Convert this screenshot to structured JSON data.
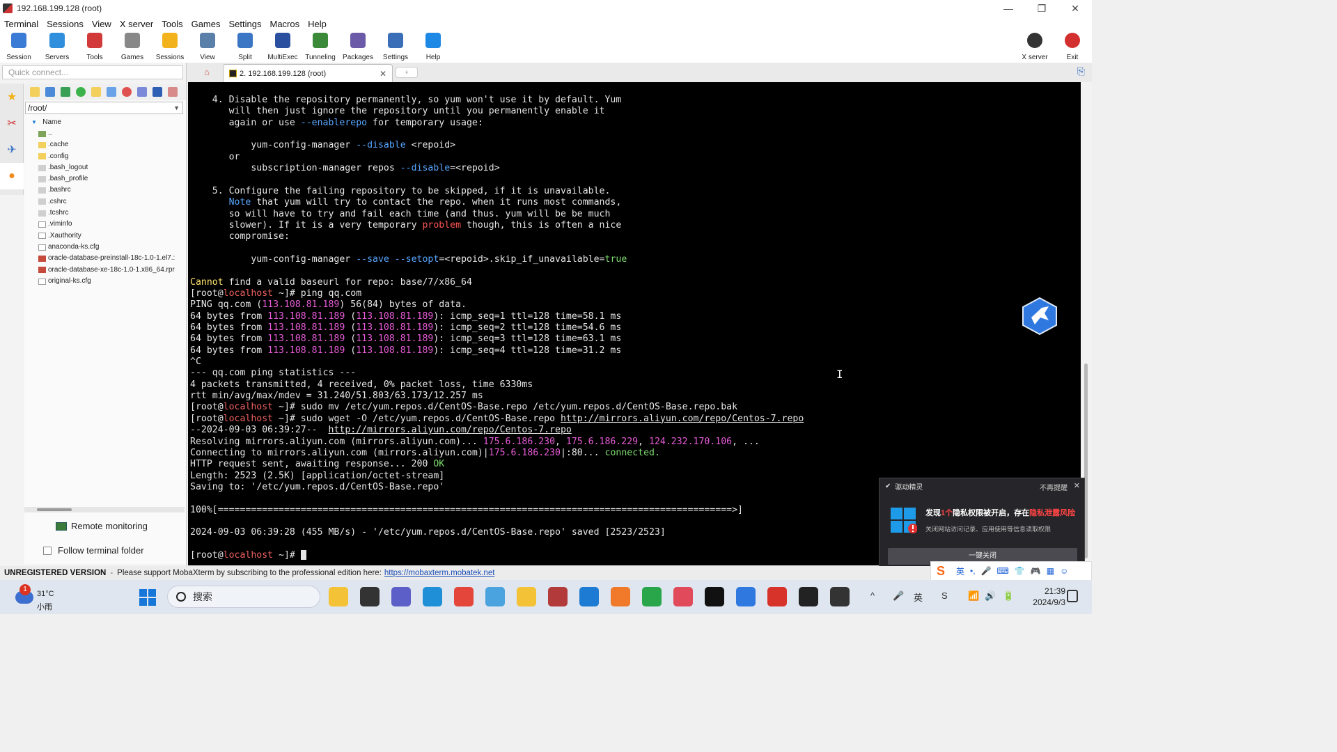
{
  "window": {
    "title": "192.168.199.128 (root)",
    "controls": [
      "—",
      "❐",
      "✕"
    ]
  },
  "menu": [
    "Terminal",
    "Sessions",
    "View",
    "X server",
    "Tools",
    "Games",
    "Settings",
    "Macros",
    "Help"
  ],
  "toolbar": {
    "items": [
      {
        "label": "Session",
        "icon": "session-icon",
        "color": "#3a7bd5"
      },
      {
        "label": "Servers",
        "icon": "servers-icon",
        "color": "#2f8fdc"
      },
      {
        "label": "Tools",
        "icon": "tools-icon",
        "color": "#d23a3a"
      },
      {
        "label": "Games",
        "icon": "games-icon",
        "color": "#888888"
      },
      {
        "label": "Sessions",
        "icon": "star-icon",
        "color": "#f2b21b"
      },
      {
        "label": "View",
        "icon": "view-icon",
        "color": "#5a7fa8"
      },
      {
        "label": "Split",
        "icon": "split-icon",
        "color": "#3b76c4"
      },
      {
        "label": "MultiExec",
        "icon": "multiexec-icon",
        "color": "#2a4f9e"
      },
      {
        "label": "Tunneling",
        "icon": "tunneling-icon",
        "color": "#3a8a3a"
      },
      {
        "label": "Packages",
        "icon": "packages-icon",
        "color": "#6a5aa8"
      },
      {
        "label": "Settings",
        "icon": "settings-icon",
        "color": "#3a6fb8"
      },
      {
        "label": "Help",
        "icon": "help-icon",
        "color": "#1e88e5"
      }
    ],
    "right": [
      {
        "label": "X server",
        "icon": "xserver-icon",
        "color": "#333333"
      },
      {
        "label": "Exit",
        "icon": "exit-icon",
        "color": "#d32f2f"
      }
    ]
  },
  "sidebar": {
    "quick_connect_placeholder": "Quick connect...",
    "path": "/root/",
    "tree_header": "Name",
    "files": [
      {
        "name": "..",
        "type": "up"
      },
      {
        "name": ".cache",
        "type": "folder"
      },
      {
        "name": ".config",
        "type": "folder"
      },
      {
        "name": ".bash_logout",
        "type": "file"
      },
      {
        "name": ".bash_profile",
        "type": "file"
      },
      {
        "name": ".bashrc",
        "type": "file"
      },
      {
        "name": ".cshrc",
        "type": "file"
      },
      {
        "name": ".tcshrc",
        "type": "file"
      },
      {
        "name": ".viminfo",
        "type": "cfg"
      },
      {
        "name": ".Xauthority",
        "type": "cfg"
      },
      {
        "name": "anaconda-ks.cfg",
        "type": "cfg"
      },
      {
        "name": "oracle-database-preinstall-18c-1.0-1.el7.:",
        "type": "rpm"
      },
      {
        "name": "oracle-database-xe-18c-1.0-1.x86_64.rpr",
        "type": "rpm"
      },
      {
        "name": "original-ks.cfg",
        "type": "cfg"
      }
    ],
    "remote_monitoring": "Remote monitoring",
    "follow_folder": "Follow terminal folder"
  },
  "tabs": {
    "active": "2. 192.168.199.128 (root)",
    "close": "✕"
  },
  "terminal": {
    "lines": [
      [
        {
          "t": "    4. Disable the repository permanently, so yum won't use it by default. Yum"
        }
      ],
      [
        {
          "t": "       will then just ignore the repository until you permanently enable it"
        }
      ],
      [
        {
          "t": "       again or use "
        },
        {
          "t": "--enablerepo",
          "c": "flag"
        },
        {
          "t": " for temporary usage:"
        }
      ],
      [
        {
          "t": ""
        }
      ],
      [
        {
          "t": "           yum-config-manager "
        },
        {
          "t": "--disable",
          "c": "flag"
        },
        {
          "t": " <repoid>"
        }
      ],
      [
        {
          "t": "       or"
        }
      ],
      [
        {
          "t": "           subscription-manager repos "
        },
        {
          "t": "--disable",
          "c": "flag"
        },
        {
          "t": "=<repoid>"
        }
      ],
      [
        {
          "t": ""
        }
      ],
      [
        {
          "t": "    5. Configure the failing repository to be skipped, if it is unavailable."
        }
      ],
      [
        {
          "t": "       "
        },
        {
          "t": "Note",
          "c": "flag"
        },
        {
          "t": " that yum will try to contact the repo. when it runs most commands,"
        }
      ],
      [
        {
          "t": "       so will have to try and fail each time (and thus. yum will be be much"
        }
      ],
      [
        {
          "t": "       slower). If it is a very temporary "
        },
        {
          "t": "problem",
          "c": "err"
        },
        {
          "t": " though, this is often a nice"
        }
      ],
      [
        {
          "t": "       compromise:"
        }
      ],
      [
        {
          "t": ""
        }
      ],
      [
        {
          "t": "           yum-config-manager "
        },
        {
          "t": "--save",
          "c": "flag"
        },
        {
          "t": " "
        },
        {
          "t": "--setopt",
          "c": "flag"
        },
        {
          "t": "=<repoid>.skip_if_unavailable="
        },
        {
          "t": "true",
          "c": "pos"
        }
      ],
      [
        {
          "t": ""
        }
      ],
      [
        {
          "t": "Cannot",
          "c": "warn"
        },
        {
          "t": " find a valid baseurl for repo: base/7/x86_64"
        }
      ],
      [
        {
          "t": "[root@"
        },
        {
          "t": "localhost",
          "c": "loc"
        },
        {
          "t": " ~]# ping qq.com"
        }
      ],
      [
        {
          "t": "PING qq.com ("
        },
        {
          "t": "113.108.81.189",
          "c": "ip"
        },
        {
          "t": ") 56(84) bytes of data."
        }
      ],
      [
        {
          "t": "64 bytes from "
        },
        {
          "t": "113.108.81.189",
          "c": "ip"
        },
        {
          "t": " ("
        },
        {
          "t": "113.108.81.189",
          "c": "ip"
        },
        {
          "t": "): icmp_seq=1 ttl=128 time=58.1 ms"
        }
      ],
      [
        {
          "t": "64 bytes from "
        },
        {
          "t": "113.108.81.189",
          "c": "ip"
        },
        {
          "t": " ("
        },
        {
          "t": "113.108.81.189",
          "c": "ip"
        },
        {
          "t": "): icmp_seq=2 ttl=128 time=54.6 ms"
        }
      ],
      [
        {
          "t": "64 bytes from "
        },
        {
          "t": "113.108.81.189",
          "c": "ip"
        },
        {
          "t": " ("
        },
        {
          "t": "113.108.81.189",
          "c": "ip"
        },
        {
          "t": "): icmp_seq=3 ttl=128 time=63.1 ms"
        }
      ],
      [
        {
          "t": "64 bytes from "
        },
        {
          "t": "113.108.81.189",
          "c": "ip"
        },
        {
          "t": " ("
        },
        {
          "t": "113.108.81.189",
          "c": "ip"
        },
        {
          "t": "): icmp_seq=4 ttl=128 time=31.2 ms"
        }
      ],
      [
        {
          "t": "^C"
        }
      ],
      [
        {
          "t": "--- qq.com ping statistics ---"
        }
      ],
      [
        {
          "t": "4 packets transmitted, 4 received, 0% packet loss, time 6330ms"
        }
      ],
      [
        {
          "t": "rtt min/avg/max/mdev = 31.240/51.803/63.173/12.257 ms"
        }
      ],
      [
        {
          "t": "[root@"
        },
        {
          "t": "localhost",
          "c": "loc"
        },
        {
          "t": " ~]# sudo mv /etc/yum.repos.d/CentOS-Base.repo /etc/yum.repos.d/CentOS-Base.repo.bak"
        }
      ],
      [
        {
          "t": "[root@"
        },
        {
          "t": "localhost",
          "c": "loc"
        },
        {
          "t": " ~]# sudo wget -O /etc/yum.repos.d/CentOS-Base.repo "
        },
        {
          "t": "http://mirrors.aliyun.com/repo/Centos-7.repo",
          "c": "lnk"
        }
      ],
      [
        {
          "t": "--2024-09-03 06:39:27--  "
        },
        {
          "t": "http://mirrors.aliyun.com/repo/Centos-7.repo",
          "c": "lnk"
        }
      ],
      [
        {
          "t": "Resolving mirrors.aliyun.com (mirrors.aliyun.com)... "
        },
        {
          "t": "175.6.186.230",
          "c": "ip"
        },
        {
          "t": ", "
        },
        {
          "t": "175.6.186.229",
          "c": "ip"
        },
        {
          "t": ", "
        },
        {
          "t": "124.232.170.106",
          "c": "ip"
        },
        {
          "t": ", ..."
        }
      ],
      [
        {
          "t": "Connecting to mirrors.aliyun.com (mirrors.aliyun.com)|"
        },
        {
          "t": "175.6.186.230",
          "c": "ip"
        },
        {
          "t": "|:80... "
        },
        {
          "t": "connected.",
          "c": "pos"
        }
      ],
      [
        {
          "t": "HTTP request sent, awaiting response... 200 "
        },
        {
          "t": "OK",
          "c": "pos"
        }
      ],
      [
        {
          "t": "Length: 2523 (2.5K) [application/octet-stream]"
        }
      ],
      [
        {
          "t": "Saving to: '/etc/yum.repos.d/CentOS-Base.repo'"
        }
      ],
      [
        {
          "t": ""
        }
      ],
      [
        {
          "t": "100%[=============================================================================================>]"
        }
      ],
      [
        {
          "t": ""
        }
      ],
      [
        {
          "t": "2024-09-03 06:39:28 (455 MB/s) - '/etc/yum.repos.d/CentOS-Base.repo' saved [2523/2523]"
        }
      ],
      [
        {
          "t": ""
        }
      ],
      [
        {
          "t": "[root@"
        },
        {
          "t": "localhost",
          "c": "loc"
        },
        {
          "t": " ~]# "
        }
      ]
    ]
  },
  "popup": {
    "app": "驱动精灵",
    "mute": "不再提醒",
    "text_a": "发现",
    "text_red1": "1个",
    "text_b": "隐私权限被开启，存在",
    "text_red2": "隐私泄露风险",
    "sub": "关闭网站访问记录、应用使用等信息读取权限",
    "button": "一键关闭"
  },
  "status": {
    "unregistered": "UNREGISTERED VERSION",
    "sep": "-",
    "support": "Please support MobaXterm by subscribing to the professional edition here:",
    "url": "https://mobaxterm.mobatek.net"
  },
  "ime": {
    "mode": "英",
    "items": [
      "•,",
      "🎤",
      "⌨",
      "👕",
      "🎮",
      "▦",
      "☺"
    ]
  },
  "taskbar": {
    "weather_badge": "1",
    "temp": "31°C",
    "condition": "小雨",
    "search_placeholder": "搜索",
    "apps": [
      {
        "name": "file-explorer-icon",
        "color": "#f3c237"
      },
      {
        "name": "task-view-icon",
        "color": "#333333"
      },
      {
        "name": "chat-icon",
        "color": "#5b5fc7"
      },
      {
        "name": "edge-icon",
        "color": "#1f8fd8"
      },
      {
        "name": "chrome-icon",
        "color": "#e5463b"
      },
      {
        "name": "photos-icon",
        "color": "#4aa3df"
      },
      {
        "name": "folder-icon",
        "color": "#f3c237"
      },
      {
        "name": "app-red-icon",
        "color": "#b33a3a"
      },
      {
        "name": "vscode-icon",
        "color": "#1e7bd3"
      },
      {
        "name": "app-orange-icon",
        "color": "#f07a2a"
      },
      {
        "name": "app-green-icon",
        "color": "#2aa64a"
      },
      {
        "name": "app-pink-icon",
        "color": "#e04a5a"
      },
      {
        "name": "terminal-icon",
        "color": "#111111"
      },
      {
        "name": "bird-app-icon",
        "color": "#2f78e0"
      },
      {
        "name": "wps-icon",
        "color": "#d7332a"
      },
      {
        "name": "app-dark-icon",
        "color": "#222222"
      },
      {
        "name": "mobaxterm-icon",
        "color": "#333333"
      },
      {
        "name": "typora-icon",
        "color": "#222222"
      }
    ],
    "tray": [
      "^",
      "🎤",
      "英",
      "S",
      "📶",
      "🔊",
      "🔋"
    ],
    "time": "21:39",
    "date": "2024/9/3"
  }
}
